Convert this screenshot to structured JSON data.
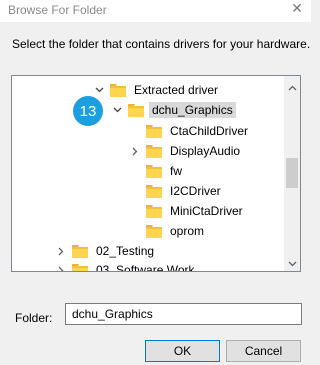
{
  "window": {
    "title": "Browse For Folder",
    "close_glyph": "✕"
  },
  "instruction": "Select the folder that contains drivers for your hardware.",
  "tree": {
    "rows": [
      {
        "label": "Extracted driver",
        "expander": "collapse-chevron"
      },
      {
        "label": "dchu_Graphics",
        "expander": "collapse-chevron",
        "selected": true
      },
      {
        "label": "CtaChildDriver",
        "expander": ""
      },
      {
        "label": "DisplayAudio",
        "expander": "expand-chevron"
      },
      {
        "label": "fw",
        "expander": ""
      },
      {
        "label": "I2CDriver",
        "expander": ""
      },
      {
        "label": "MiniCtaDriver",
        "expander": ""
      },
      {
        "label": "oprom",
        "expander": ""
      },
      {
        "label": "02_Testing",
        "expander": "expand-chevron"
      },
      {
        "label": "03_Software Work",
        "expander": "expand-chevron"
      }
    ]
  },
  "step_badge": "13",
  "folder_field": {
    "label": "Folder:",
    "value": "dchu_Graphics"
  },
  "buttons": {
    "ok": "OK",
    "cancel": "Cancel"
  },
  "colors": {
    "folder": "#ffd44f",
    "folder_dark": "#e8b53a",
    "badge": "#1c9fe0",
    "selection": "#d9d9d9"
  }
}
